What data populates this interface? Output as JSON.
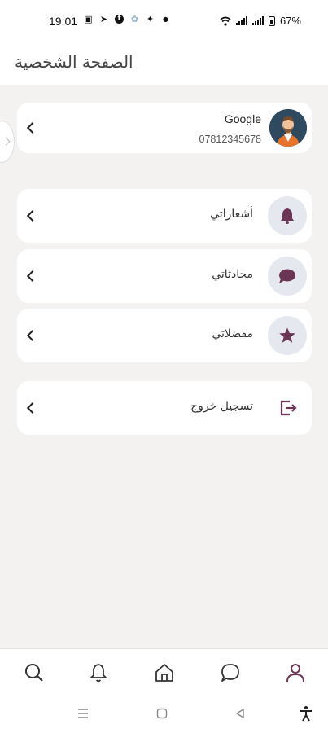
{
  "status_bar": {
    "time": "19:01",
    "battery": "67%",
    "left_icons": [
      "gallery-icon",
      "telegram-icon",
      "facebook-icon",
      "app-icon",
      "twitter-icon",
      "dot-icon"
    ],
    "right_icons": [
      "wifi-icon",
      "signal-icon",
      "signal-icon",
      "battery-icon"
    ]
  },
  "header": {
    "title": "الصفحة الشخصية"
  },
  "profile": {
    "name": "Google",
    "phone": "07812345678",
    "avatar_icon": "user-avatar"
  },
  "menu": [
    {
      "label": "أشعاراتي",
      "icon": "bell-icon"
    },
    {
      "label": "محادثاتي",
      "icon": "chat-bubble-icon"
    },
    {
      "label": "مفضلاتي",
      "icon": "star-icon"
    }
  ],
  "logout": {
    "label": "تسجيل خروج",
    "icon": "logout-icon"
  },
  "bottom_nav": [
    "search-icon",
    "bell-icon",
    "home-icon",
    "chat-icon",
    "profile-icon"
  ],
  "colors": {
    "accent": "#6b3556",
    "background": "#f4f2f1",
    "icon_circle": "#e6e8ef"
  }
}
